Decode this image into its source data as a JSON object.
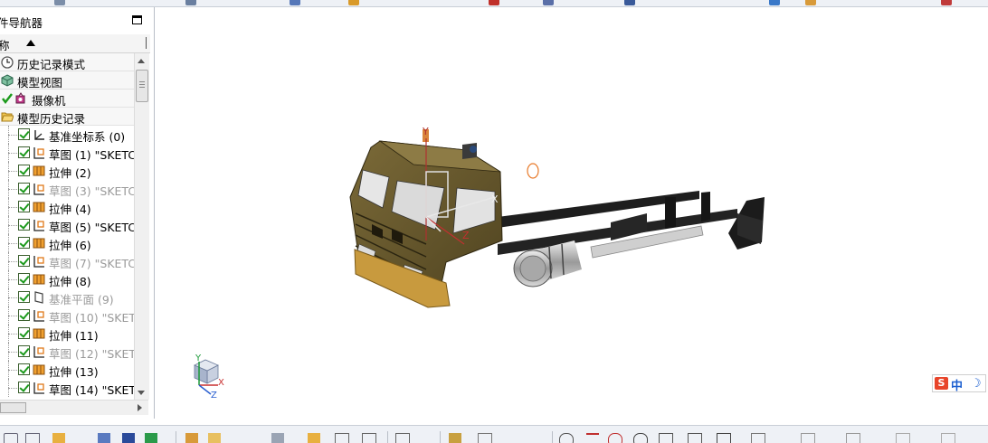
{
  "navigator": {
    "title": "件导航器",
    "column_name": "称",
    "items": [
      {
        "label": "历史记录模式",
        "icon": "clock-icon",
        "state": "normal"
      },
      {
        "label": "模型视图",
        "icon": "cube-view-icon",
        "state": "normal"
      },
      {
        "label": "摄像机",
        "icon": "camera-icon",
        "state": "normal"
      },
      {
        "label": "模型历史记录",
        "icon": "folder-open-icon",
        "state": "normal"
      },
      {
        "label": "基准坐标系 (0)",
        "icon": "datum-csys-icon",
        "state": "normal"
      },
      {
        "label": "草图 (1) \"SKETC...",
        "icon": "sketch-icon",
        "state": "normal"
      },
      {
        "label": "拉伸 (2)",
        "icon": "extrude-icon",
        "state": "normal"
      },
      {
        "label": "草图 (3) \"SKETC...",
        "icon": "sketch-icon",
        "state": "dim"
      },
      {
        "label": "拉伸 (4)",
        "icon": "extrude-icon",
        "state": "normal"
      },
      {
        "label": "草图 (5) \"SKETC...",
        "icon": "sketch-icon",
        "state": "normal"
      },
      {
        "label": "拉伸 (6)",
        "icon": "extrude-icon",
        "state": "normal"
      },
      {
        "label": "草图 (7) \"SKETC...",
        "icon": "sketch-icon",
        "state": "dim"
      },
      {
        "label": "拉伸 (8)",
        "icon": "extrude-icon",
        "state": "normal"
      },
      {
        "label": "基准平面 (9)",
        "icon": "datum-plane-icon",
        "state": "dim"
      },
      {
        "label": "草图 (10) \"SKET...",
        "icon": "sketch-icon",
        "state": "dim"
      },
      {
        "label": "拉伸 (11)",
        "icon": "extrude-icon",
        "state": "normal"
      },
      {
        "label": "草图 (12) \"SKET...",
        "icon": "sketch-icon",
        "state": "dim"
      },
      {
        "label": "拉伸 (13)",
        "icon": "extrude-icon",
        "state": "normal"
      },
      {
        "label": "草图 (14) \"SKET...",
        "icon": "sketch-icon",
        "state": "normal"
      }
    ]
  },
  "viewport": {
    "axis_labels": {
      "y": "Y",
      "x": "X",
      "z": "Z"
    },
    "triad_labels": {
      "y": "Y",
      "x": "X",
      "z": "Z"
    },
    "model": "truck-cab-chassis"
  },
  "ime": {
    "logo": "S",
    "mode": "中",
    "moon": "☽"
  },
  "colors": {
    "cab": "#6b5a2a",
    "bumper": "#c89a3e",
    "frame": "#1a1a1a",
    "tank": "#b8b8b8",
    "check": "#1c9a1c",
    "extrude": "#e08a1a"
  }
}
